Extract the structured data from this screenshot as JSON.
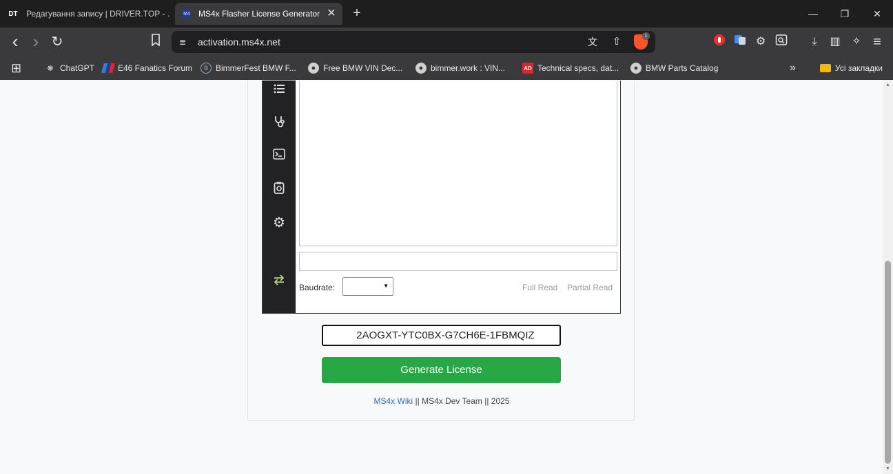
{
  "tabs": [
    {
      "favicon": "DT",
      "title": "Редагування запису | DRIVER.TOP - …"
    },
    {
      "favicon": "M4",
      "title": "MS4x Flasher License Generator",
      "close": "✕"
    }
  ],
  "new_tab": "+",
  "window_controls": {
    "minimize": "—",
    "restore": "❐",
    "close": "✕"
  },
  "toolbar": {
    "back": "‹",
    "forward": "›",
    "reload": "↻",
    "bookmark": "☐",
    "site_info": "≣",
    "url": "activation.ms4x.net",
    "translate": "文",
    "share": "⇧",
    "brave_badge": "1",
    "extensions": "⚙",
    "downloads": "⤓",
    "sidebar": "▥",
    "leo": "✧",
    "menu": "≡"
  },
  "bookmarks": {
    "apps": "⊞",
    "items": [
      {
        "label": "ChatGPT",
        "icon": "chatgpt-icon"
      },
      {
        "label": "E46 Fanatics Forum",
        "icon": "e46-icon"
      },
      {
        "label": "BimmerFest BMW F...",
        "icon": "bimmerfest-icon"
      },
      {
        "label": "Free BMW VIN Dec...",
        "icon": "globe-icon"
      },
      {
        "label": "bimmer.work : VIN...",
        "icon": "globe-icon"
      },
      {
        "label": "Technical specs, dat...",
        "icon": "ad-icon"
      },
      {
        "label": "BMW Parts Catalog",
        "icon": "globe-icon"
      }
    ],
    "overflow": "»",
    "all_bookmarks": "Усі закладки"
  },
  "app": {
    "sidebar_icons": [
      "list-icon",
      "stethoscope-icon",
      "terminal-icon",
      "file-check-icon",
      "gear-icon",
      "swap-arrows-icon"
    ],
    "baudrate_label": "Baudrate:",
    "baudrate_value": "",
    "full_read": "Full Read",
    "partial_read": "Partial Read"
  },
  "license": {
    "value": "2AOGXT-YTC0BX-G7CH6E-1FBMQIZ",
    "button": "Generate License"
  },
  "footer": {
    "wiki": "MS4x Wiki",
    "sep1": " || ",
    "team": "MS4x Dev Team",
    "sep2": " || ",
    "year": "2025"
  },
  "colors": {
    "accent_green": "#28a745",
    "link_blue": "#2a6ebb",
    "chrome_dark": "#3a3a3c"
  }
}
